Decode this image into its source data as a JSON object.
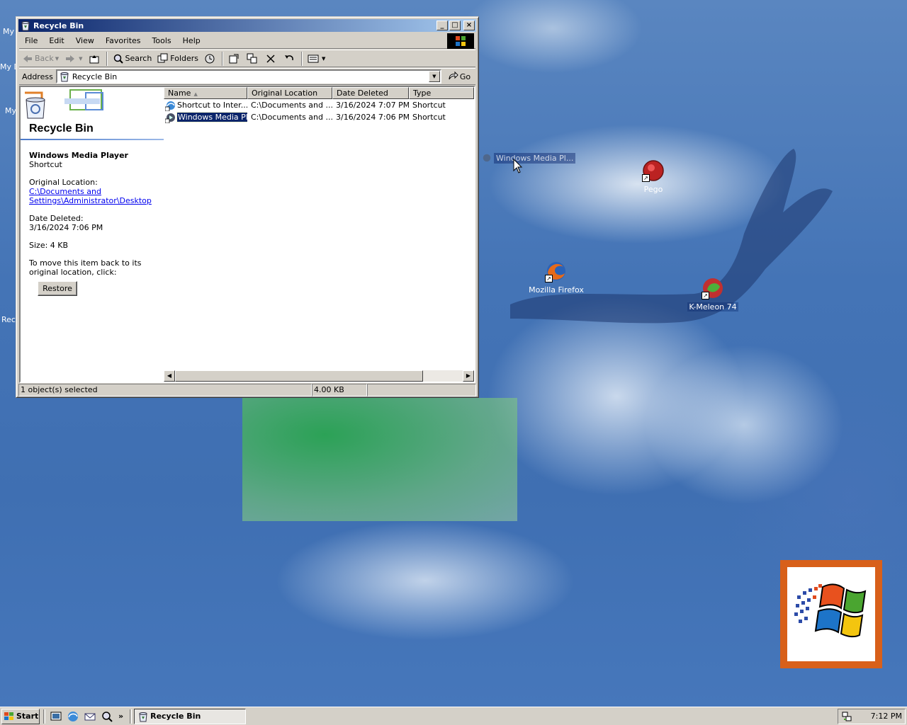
{
  "window": {
    "title": "Recycle Bin",
    "controls": {
      "minimize": "_",
      "maximize": "□",
      "close": "×"
    }
  },
  "menu": [
    "File",
    "Edit",
    "View",
    "Favorites",
    "Tools",
    "Help"
  ],
  "toolbar": {
    "back": "Back",
    "search": "Search",
    "folders": "Folders"
  },
  "address": {
    "label": "Address",
    "value": "Recycle Bin",
    "go": "Go"
  },
  "webview": {
    "title": "Recycle Bin",
    "item_name": "Windows Media Player",
    "item_type": "Shortcut",
    "original_location_label": "Original Location:",
    "original_location_link": "C:\\Documents and Settings\\Administrator\\Desktop",
    "date_deleted_label": "Date Deleted:",
    "date_deleted": "3/16/2024 7:06 PM",
    "size": "Size: 4 KB",
    "restore_hint": "To move this item back to its original location, click:",
    "restore_button": "Restore"
  },
  "list": {
    "columns": [
      "Name",
      "Original Location",
      "Date Deleted",
      "Type"
    ],
    "rows": [
      {
        "name": "Shortcut to Inter...",
        "location": "C:\\Documents and ...",
        "date": "3/16/2024 7:07 PM",
        "type": "Shortcut",
        "selected": false
      },
      {
        "name": "Windows Media Pl...",
        "location": "C:\\Documents and ...",
        "date": "3/16/2024 7:06 PM",
        "type": "Shortcut",
        "selected": true
      }
    ]
  },
  "status": {
    "selection": "1 object(s) selected",
    "size": "4.00 KB"
  },
  "desktop": {
    "partial_labels": [
      "My",
      "My D",
      "My",
      "Rec"
    ],
    "icons": [
      {
        "name": "Pego"
      },
      {
        "name": "Mozilla Firefox"
      },
      {
        "name": "K-Meleon 74"
      }
    ],
    "drag_ghost_label": "Windows Media Pl..."
  },
  "taskbar": {
    "start": "Start",
    "ql_more": "»",
    "task": "Recycle Bin",
    "clock": "7:12 PM"
  },
  "colors": {
    "titlebar_start": "#0a246a",
    "titlebar_end": "#a6caf0",
    "selection": "#0a246a",
    "face": "#d4d0c8"
  }
}
